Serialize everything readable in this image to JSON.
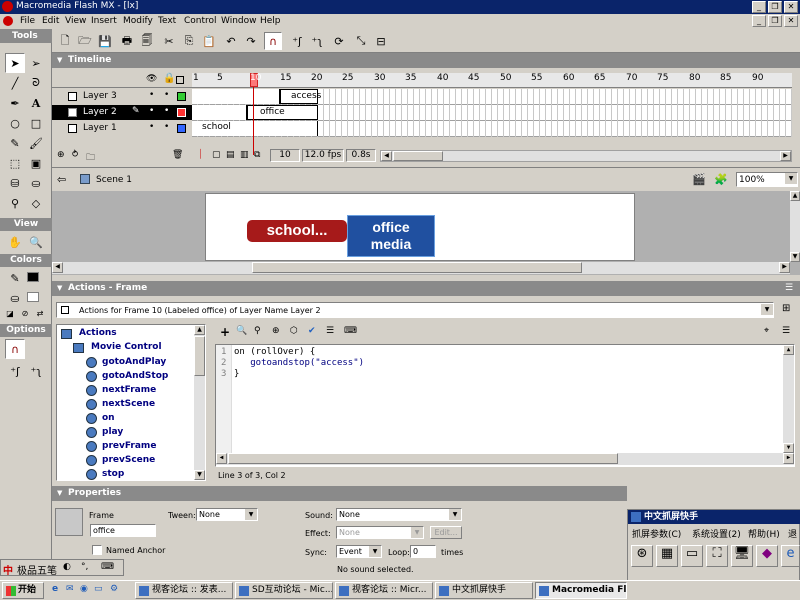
{
  "window": {
    "title": "Macromedia Flash MX - [lx]"
  },
  "menu": [
    "File",
    "Edit",
    "View",
    "Insert",
    "Modify",
    "Text",
    "Control",
    "Window",
    "Help"
  ],
  "tools_panel": {
    "title": "Tools",
    "view_label": "View",
    "colors_label": "Colors",
    "options_label": "Options"
  },
  "timeline": {
    "title": "Timeline",
    "frame_numbers": [
      "1",
      "5",
      "10",
      "15",
      "20",
      "25",
      "30",
      "35",
      "40",
      "45",
      "50",
      "55",
      "60",
      "65",
      "70",
      "75",
      "80",
      "85",
      "90"
    ],
    "layers": [
      {
        "name": "Layer 3",
        "label": "access"
      },
      {
        "name": "Layer 2",
        "label": "office"
      },
      {
        "name": "Layer 1",
        "label": "school"
      }
    ],
    "current_frame": "10",
    "fps": "12.0 fps",
    "time": "0.8s"
  },
  "scene_bar": {
    "scene": "Scene 1",
    "zoom": "100%"
  },
  "stage": {
    "button1": "school...",
    "button2_line1": "office",
    "button2_line2": "media"
  },
  "actions": {
    "title": "Actions - Frame",
    "subtitle": "Actions for Frame 10 (Labeled office)  of Layer Name Layer 2",
    "tree_root": "Actions",
    "tree_folder": "Movie Control",
    "tree_items": [
      "gotoAndPlay",
      "gotoAndStop",
      "nextFrame",
      "nextScene",
      "on",
      "play",
      "prevFrame",
      "prevScene",
      "stop"
    ],
    "code_lines": [
      {
        "num": "1",
        "text": "on (rollOver) {"
      },
      {
        "num": "2",
        "text": "   gotoandstop(\"access\")"
      },
      {
        "num": "3",
        "text": "}"
      }
    ],
    "status": "Line 3 of 3, Col 2"
  },
  "properties": {
    "title": "Properties",
    "frame_label": "Frame",
    "frame_value": "office",
    "named_anchor": "Named Anchor",
    "tween_label": "Tween:",
    "tween_value": "None",
    "sound_label": "Sound:",
    "sound_value": "None",
    "effect_label": "Effect:",
    "effect_value": "None",
    "edit_button": "Edit...",
    "sync_label": "Sync:",
    "sync_value": "Event",
    "loop_label": "Loop:",
    "loop_value": "0",
    "times_label": "times",
    "no_sound": "No sound selected."
  },
  "capture_panel": {
    "title": "中文抓屏快手",
    "menu": [
      "抓屏参数(C)",
      "系统设置(2)",
      "帮助(H)",
      "退"
    ]
  },
  "ime_bar": {
    "text": "极品五笔"
  },
  "taskbar": {
    "start": "开始",
    "tasks": [
      "视客论坛 :: 发表...",
      "SD互动论坛 - Mic...",
      "视客论坛 :: Micr...",
      "中文抓屏快手",
      "Macromedia Flash ..."
    ]
  },
  "colors": {
    "title_bar": "#0a246a",
    "selected_layer": "#000000",
    "button_red": "#a61a1a",
    "button_blue": "#2050a0",
    "playhead": "#cc0000",
    "code_string": "#000080"
  }
}
